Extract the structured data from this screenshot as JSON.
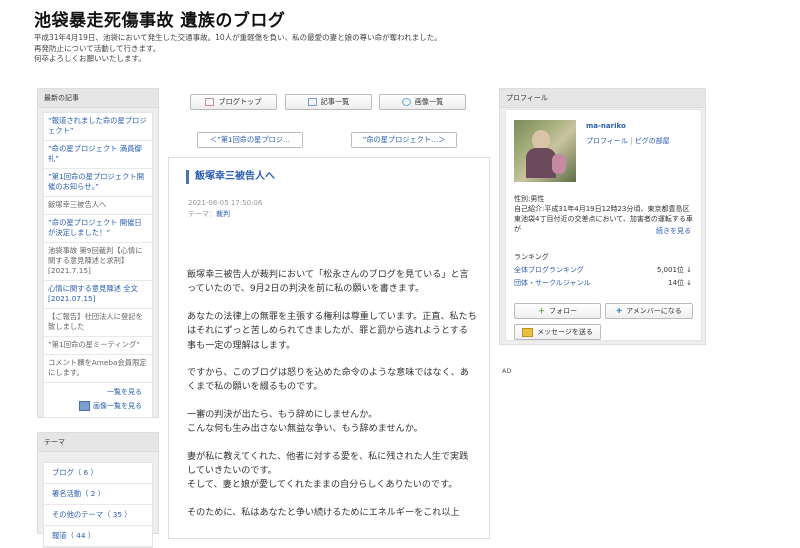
{
  "header": {
    "title": "池袋暴走死傷事故 遺族のブログ",
    "desc": [
      "平成31年4月19日、池袋において発生した交通事故。10人が重軽傷を負い、私の最愛の妻と娘の尊い命が奪われました。",
      "再発防止について活動して行きます。",
      "何卒よろしくお願いいたします。"
    ]
  },
  "sidebar": {
    "recent_head": "最新の記事",
    "recent": [
      "”報道されました命の星プロジェクト”",
      "”命の星プロジェクト 満員御礼”",
      "”第1回命の星プロジェクト開催のお知らせ。”",
      "飯塚幸三被告人へ",
      "”命の星プロジェクト 開催日が決定しました！”",
      "池袋事故 第9回裁判【心情に関する意見陳述と求刑】[2021.7.15]",
      "心情に関する意見陳述 全文 [2021.07.15]",
      "【ご報告】社団法人に登記を致しました",
      "”第1回命の星ミーティング”",
      "コメント欄をAmeba会員限定にします。"
    ],
    "more_list": "一覧を見る",
    "more_images": "画像一覧を見る",
    "theme_head": "テーマ",
    "themes": [
      "ブログ（ 6 ）",
      "署名活動（ 2 ）",
      "その他のテーマ（ 35 ）",
      "報道（ 44 ）"
    ]
  },
  "nav": {
    "blog_top": "ブログトップ",
    "article_list": "記事一覧",
    "image_list": "画像一覧",
    "prev": "＜”第1回命の星プロジ…",
    "next": "”命の星プロジェクト…＞"
  },
  "article": {
    "title": "飯塚幸三被告人へ",
    "date": "2021-08-05 17:50:06",
    "theme_label": "テーマ：",
    "theme": "裁判",
    "body": [
      "飯塚幸三被告人が裁判において「松永さんのブログを見ている」と言っていたので、9月2日の判決を前に私の願いを書きます。",
      "あなたの法律上の無罪を主張する権利は尊重しています。正直、私たちはそれにずっと苦しめられてきましたが、罪と罰から逃れようとする事も一定の理解はします。",
      "ですから、このブログは怒りを込めた命令のような意味ではなく、あくまで私の願いを綴るものです。",
      "一審の判決が出たら、もう辞めにしませんか。\nこんな何も生み出さない無益な争い、もう辞めませんか。",
      "妻が私に教えてくれた、他者に対する愛を、私に残された人生で実践していきたいのです。\nそして、妻と娘が愛してくれたままの自分らしくありたいのです。",
      "そのために、私はあなたと争い続けるためにエネルギーをこれ以上"
    ]
  },
  "profile": {
    "head": "プロフィール",
    "name": "ma-nariko",
    "link_profile": "プロフィール",
    "link_room": "ピグの部屋",
    "info": "性別:男性\n自己紹介:平成31年4月19日12時23分頃、東京都豊島区東池袋4丁目付近の交差点において、加害者の運転する車が",
    "more": "続きを見る",
    "ranking_title": "ランキング",
    "ranks": [
      {
        "label": "全体ブログランキング",
        "value": "5,001位 ↓"
      },
      {
        "label": "団体・サークルジャンル",
        "value": "14位 ↓"
      }
    ],
    "follow": "フォロー",
    "amember": "アメンバーになる",
    "message": "メッセージを送る"
  },
  "ad_label": "AD"
}
